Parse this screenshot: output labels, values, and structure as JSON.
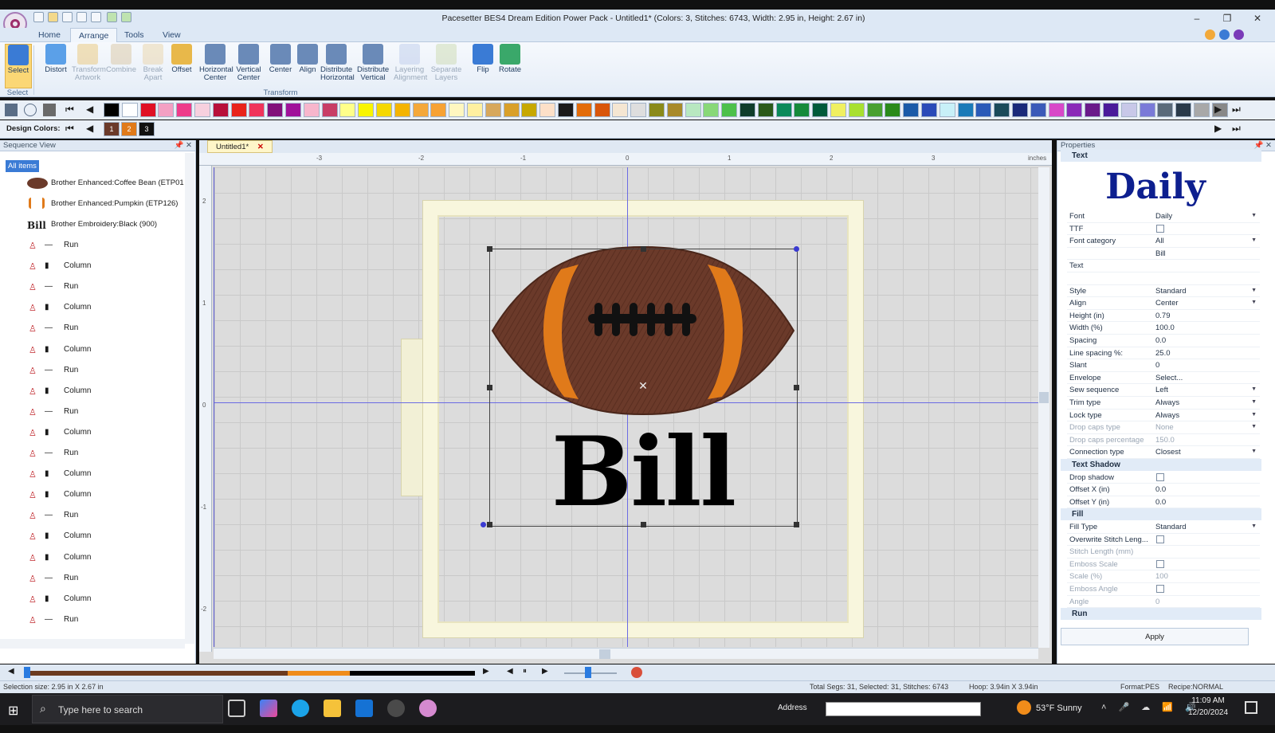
{
  "window": {
    "title": "Pacesetter BES4 Dream Edition Power Pack - Untitled1* (Colors: 3, Stitches: 6743, Width: 2.95 in, Height: 2.67 in)",
    "minimize": "–",
    "restore": "❐",
    "close": "✕"
  },
  "ribbon": {
    "tabs": [
      "Home",
      "Arrange",
      "Tools",
      "View"
    ],
    "buttons": [
      {
        "label": "Select",
        "enabled": true
      },
      {
        "label": "Distort",
        "enabled": true
      },
      {
        "label": "Transform Artwork",
        "enabled": false
      },
      {
        "label": "Combine",
        "enabled": false
      },
      {
        "label": "Break Apart",
        "enabled": false
      },
      {
        "label": "Offset",
        "enabled": true
      },
      {
        "label": "Horizontal Center",
        "enabled": true
      },
      {
        "label": "Vertical Center",
        "enabled": true
      },
      {
        "label": "Center",
        "enabled": true
      },
      {
        "label": "Align",
        "enabled": true
      },
      {
        "label": "Distribute Horizontal",
        "enabled": true
      },
      {
        "label": "Distribute Vertical",
        "enabled": true
      },
      {
        "label": "Layering Alignment",
        "enabled": false
      },
      {
        "label": "Separate Layers",
        "enabled": false
      },
      {
        "label": "Flip",
        "enabled": true
      },
      {
        "label": "Rotate",
        "enabled": true
      }
    ],
    "groups": {
      "select": "Select",
      "transform": "Transform"
    }
  },
  "palette": {
    "colors": [
      "#000000",
      "#ffffff",
      "#e01025",
      "#f3a0c3",
      "#ee3c8a",
      "#f7d0de",
      "#b8103a",
      "#e8231b",
      "#f0345a",
      "#82107a",
      "#a0129a",
      "#f7b6cc",
      "#c83d66",
      "#ffff8a",
      "#f9f500",
      "#f5d800",
      "#f4b400",
      "#f4a83a",
      "#f7a234",
      "#fff7c0",
      "#fff0a0",
      "#d7a85c",
      "#d9a02a",
      "#c7a800",
      "#fde0c8",
      "#1a1a1a",
      "#e36c0a",
      "#d9560b",
      "#f5e6d2",
      "#dedede",
      "#8a8a1a",
      "#a88a2a",
      "#b8e8c0",
      "#88d878",
      "#4cc04a",
      "#0f3d2a",
      "#2b5a1a",
      "#0a8a5a",
      "#158a3a",
      "#005a3a",
      "#f0f060",
      "#a8e030",
      "#48a030",
      "#2a8a1a",
      "#1a5aa8",
      "#2a4ab8",
      "#c8f0f8",
      "#1a7ab8",
      "#2a5ab8",
      "#1a4a5a",
      "#1a2a7a",
      "#3a5ab8",
      "#d848c8",
      "#8a2ab8",
      "#6a1a8a",
      "#4a1a9a",
      "#c8c8e8",
      "#7a7ad8",
      "#5a6a7a",
      "#2a3a4a",
      "#a8a8a8",
      "#888888"
    ],
    "design_label": "Design Colors:",
    "design_colors": [
      {
        "num": "1",
        "color": "#6b3a2a"
      },
      {
        "num": "2",
        "color": "#e07a1a"
      },
      {
        "num": "3",
        "color": "#111111"
      }
    ]
  },
  "sequence": {
    "title": "Sequence View",
    "all_items": "All items",
    "threads": [
      "Brother Enhanced:Coffee Bean (ETP01",
      "Brother Enhanced:Pumpkin (ETP126)",
      "Brother Embroidery:Black (900)"
    ],
    "thread_thumb_bill": "Bill",
    "items": [
      "Run",
      "Column",
      "Run",
      "Column",
      "Run",
      "Column",
      "Run",
      "Column",
      "Run",
      "Column",
      "Run",
      "Column",
      "Column",
      "Run",
      "Column",
      "Column",
      "Run",
      "Column",
      "Run"
    ]
  },
  "document": {
    "tab": "Untitled1*",
    "units": "inches"
  },
  "ruler": {
    "x": [
      "-3",
      "-2",
      "-1",
      "0",
      "1",
      "2",
      "3"
    ],
    "y": [
      "2",
      "1",
      "0",
      "-1",
      "-2"
    ]
  },
  "design": {
    "text": "Bill"
  },
  "properties": {
    "title": "Properties",
    "preview": "Daily",
    "sections": {
      "text": "Text",
      "shadow": "Text Shadow",
      "fill": "Fill",
      "run": "Run"
    },
    "text_rows": [
      {
        "k": "Font",
        "v": "Daily",
        "dd": true,
        "enabled": true
      },
      {
        "k": "TTF",
        "v": "",
        "check": true,
        "enabled": true
      },
      {
        "k": "Font category",
        "v": "All",
        "dd": true,
        "enabled": true
      },
      {
        "k": "",
        "v": "Bill",
        "enabled": true
      },
      {
        "k": "Text",
        "v": "",
        "enabled": true
      },
      {
        "k": "",
        "v": "",
        "enabled": true
      },
      {
        "k": "Style",
        "v": "Standard",
        "dd": true,
        "enabled": true
      },
      {
        "k": "Align",
        "v": "Center",
        "dd": true,
        "enabled": true
      },
      {
        "k": "Height (in)",
        "v": "0.79",
        "enabled": true
      },
      {
        "k": "Width (%)",
        "v": "100.0",
        "enabled": true
      },
      {
        "k": "Spacing",
        "v": "0.0",
        "enabled": true
      },
      {
        "k": "Line spacing %:",
        "v": "25.0",
        "enabled": true
      },
      {
        "k": "Slant",
        "v": "0",
        "enabled": true
      },
      {
        "k": "Envelope",
        "v": "Select...",
        "enabled": true
      },
      {
        "k": "Sew sequence",
        "v": "Left",
        "dd": true,
        "enabled": true
      },
      {
        "k": "Trim type",
        "v": "Always",
        "dd": true,
        "enabled": true
      },
      {
        "k": "Lock type",
        "v": "Always",
        "dd": true,
        "enabled": true
      },
      {
        "k": "Drop caps type",
        "v": "None",
        "dd": true,
        "enabled": false
      },
      {
        "k": "Drop caps percentage",
        "v": "150.0",
        "enabled": false
      },
      {
        "k": "Connection type",
        "v": "Closest",
        "dd": true,
        "enabled": true
      }
    ],
    "shadow_rows": [
      {
        "k": "Drop shadow",
        "v": "",
        "check": true,
        "enabled": true
      },
      {
        "k": "Offset X (in)",
        "v": "0.0",
        "enabled": true
      },
      {
        "k": "Offset Y (in)",
        "v": "0.0",
        "enabled": true
      }
    ],
    "fill_rows": [
      {
        "k": "Fill Type",
        "v": "Standard",
        "dd": true,
        "enabled": true
      },
      {
        "k": "Overwrite Stitch Leng...",
        "v": "",
        "check": true,
        "enabled": true
      },
      {
        "k": "Stitch Length (mm)",
        "v": "",
        "enabled": false
      },
      {
        "k": "Emboss Scale",
        "v": "",
        "check": true,
        "enabled": false
      },
      {
        "k": "Scale (%)",
        "v": "100",
        "enabled": false
      },
      {
        "k": "Emboss Angle",
        "v": "",
        "check": true,
        "enabled": false
      },
      {
        "k": "Angle",
        "v": "0",
        "enabled": false
      }
    ],
    "apply": "Apply"
  },
  "status": {
    "selection": "Selection size: 2.95 in X 2.67 in",
    "segs": "Total Segs: 31, Selected: 31, Stitches: 6743",
    "hoop": "Hoop: 3.94in X 3.94in",
    "format": "Format:PES",
    "recipe": "Recipe:NORMAL"
  },
  "taskbar": {
    "search": "Type here to search",
    "address": "Address",
    "weather": "53°F  Sunny",
    "time": "11:09 AM",
    "date": "12/20/2024"
  }
}
